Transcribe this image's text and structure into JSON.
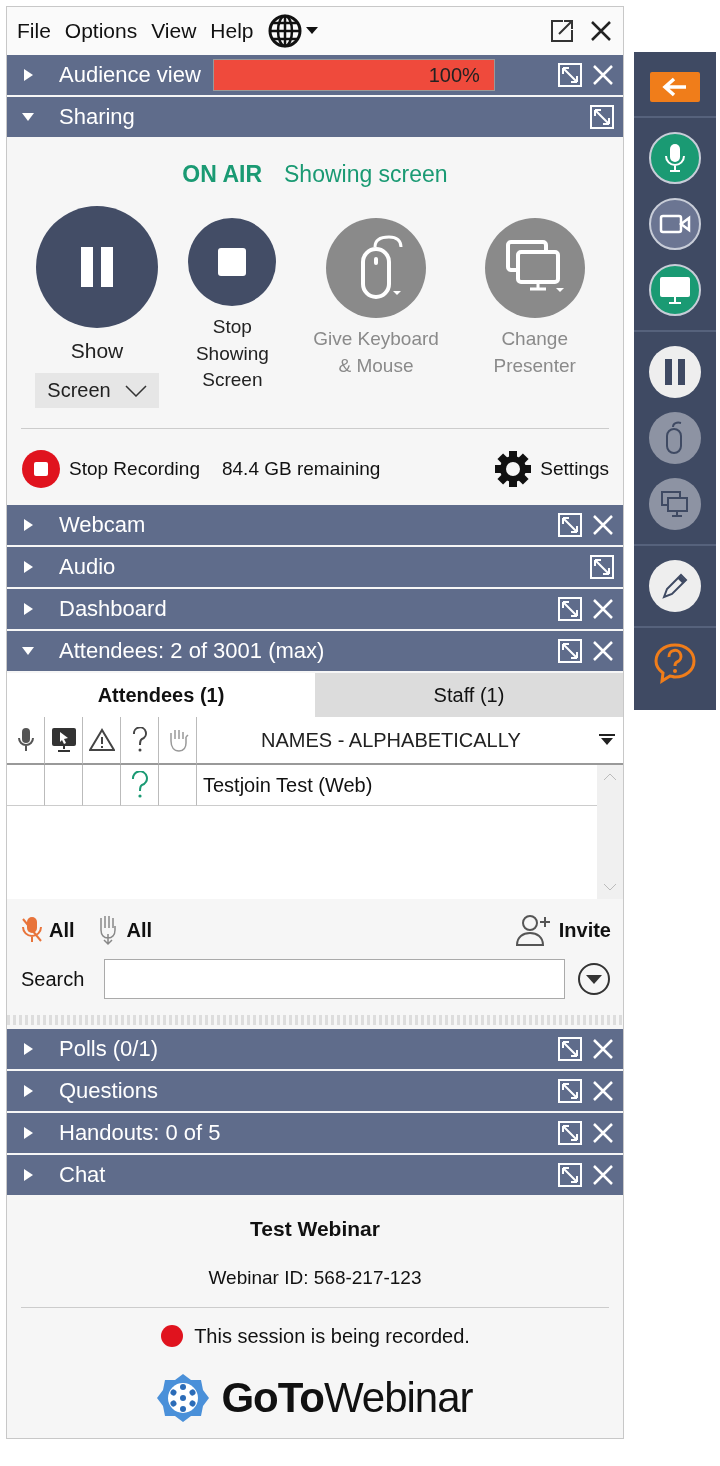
{
  "menu": {
    "items": [
      "File",
      "Options",
      "View",
      "Help"
    ]
  },
  "panes": [
    {
      "kind": "meter",
      "title": "Audience view",
      "expanded": false,
      "closable": true,
      "meter": {
        "level": 1,
        "reading": "100%"
      }
    },
    {
      "kind": "sharing",
      "title": "Sharing",
      "expanded": true,
      "closable": false
    },
    {
      "kind": "plain",
      "title": "Webcam",
      "expanded": false,
      "closable": true
    },
    {
      "kind": "plain",
      "title": "Audio",
      "expanded": false,
      "closable": false
    },
    {
      "kind": "plain",
      "title": "Dashboard",
      "expanded": false,
      "closable": true
    },
    {
      "kind": "attendees",
      "title": "Attendees:  2 of 3001 (max)",
      "expanded": true,
      "closable": true
    },
    {
      "kind": "plain",
      "title": "Polls (0/1)",
      "expanded": false,
      "closable": true
    },
    {
      "kind": "plain",
      "title": "Questions",
      "expanded": false,
      "closable": true
    },
    {
      "kind": "plain",
      "title": "Handouts: 0 of 5",
      "expanded": false,
      "closable": true
    },
    {
      "kind": "plain",
      "title": "Chat",
      "expanded": false,
      "closable": true
    }
  ],
  "sharing": {
    "on_air": "ON AIR",
    "status": "Showing screen",
    "actions": [
      {
        "kind": "pause",
        "label": "Show",
        "dropdown": "Screen",
        "disabled": false
      },
      {
        "kind": "stop",
        "label": "Stop Showing Screen",
        "disabled": false
      },
      {
        "kind": "mouse",
        "label": "Give Keyboard & Mouse",
        "disabled": true
      },
      {
        "kind": "screens",
        "label": "Change Presenter",
        "disabled": true
      }
    ],
    "stop_recording": "Stop Recording",
    "remaining": "84.4 GB remaining",
    "settings": "Settings"
  },
  "attendees": {
    "tabs": [
      {
        "label": "Attendees (1)",
        "selected": true
      },
      {
        "label": "Staff (1)",
        "selected": false
      }
    ],
    "name_column": "NAMES - ALPHABETICALLY",
    "rows": [
      {
        "name": "Testjoin Test (Web)",
        "question": true
      }
    ],
    "mute_all": "All",
    "lower_hands": "All",
    "invite": "Invite",
    "search_label": "Search"
  },
  "footer": {
    "title": "Test Webinar",
    "webinar_id": "Webinar ID: 568-217-123",
    "notice": "This session is being recorded.",
    "logo_bold": "GoTo",
    "logo_light": "Webinar"
  },
  "toolbar": [
    {
      "kind": "mic",
      "on": true
    },
    {
      "kind": "camera",
      "on": false
    },
    {
      "kind": "screen",
      "on": true
    }
  ]
}
